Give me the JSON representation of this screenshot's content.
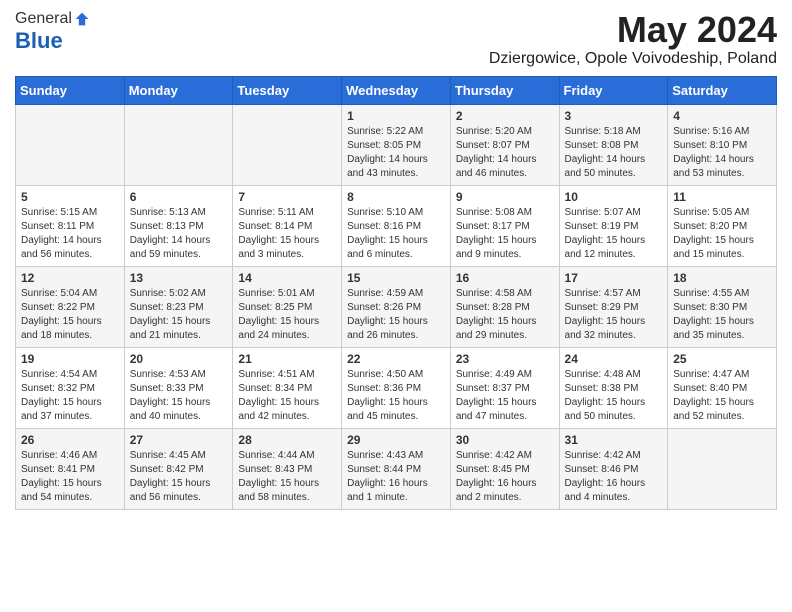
{
  "header": {
    "logo_general": "General",
    "logo_blue": "Blue",
    "month_title": "May 2024",
    "location": "Dziergowice, Opole Voivodeship, Poland"
  },
  "days_of_week": [
    "Sunday",
    "Monday",
    "Tuesday",
    "Wednesday",
    "Thursday",
    "Friday",
    "Saturday"
  ],
  "weeks": [
    [
      {
        "day": "",
        "content": ""
      },
      {
        "day": "",
        "content": ""
      },
      {
        "day": "",
        "content": ""
      },
      {
        "day": "1",
        "content": "Sunrise: 5:22 AM\nSunset: 8:05 PM\nDaylight: 14 hours\nand 43 minutes."
      },
      {
        "day": "2",
        "content": "Sunrise: 5:20 AM\nSunset: 8:07 PM\nDaylight: 14 hours\nand 46 minutes."
      },
      {
        "day": "3",
        "content": "Sunrise: 5:18 AM\nSunset: 8:08 PM\nDaylight: 14 hours\nand 50 minutes."
      },
      {
        "day": "4",
        "content": "Sunrise: 5:16 AM\nSunset: 8:10 PM\nDaylight: 14 hours\nand 53 minutes."
      }
    ],
    [
      {
        "day": "5",
        "content": "Sunrise: 5:15 AM\nSunset: 8:11 PM\nDaylight: 14 hours\nand 56 minutes."
      },
      {
        "day": "6",
        "content": "Sunrise: 5:13 AM\nSunset: 8:13 PM\nDaylight: 14 hours\nand 59 minutes."
      },
      {
        "day": "7",
        "content": "Sunrise: 5:11 AM\nSunset: 8:14 PM\nDaylight: 15 hours\nand 3 minutes."
      },
      {
        "day": "8",
        "content": "Sunrise: 5:10 AM\nSunset: 8:16 PM\nDaylight: 15 hours\nand 6 minutes."
      },
      {
        "day": "9",
        "content": "Sunrise: 5:08 AM\nSunset: 8:17 PM\nDaylight: 15 hours\nand 9 minutes."
      },
      {
        "day": "10",
        "content": "Sunrise: 5:07 AM\nSunset: 8:19 PM\nDaylight: 15 hours\nand 12 minutes."
      },
      {
        "day": "11",
        "content": "Sunrise: 5:05 AM\nSunset: 8:20 PM\nDaylight: 15 hours\nand 15 minutes."
      }
    ],
    [
      {
        "day": "12",
        "content": "Sunrise: 5:04 AM\nSunset: 8:22 PM\nDaylight: 15 hours\nand 18 minutes."
      },
      {
        "day": "13",
        "content": "Sunrise: 5:02 AM\nSunset: 8:23 PM\nDaylight: 15 hours\nand 21 minutes."
      },
      {
        "day": "14",
        "content": "Sunrise: 5:01 AM\nSunset: 8:25 PM\nDaylight: 15 hours\nand 24 minutes."
      },
      {
        "day": "15",
        "content": "Sunrise: 4:59 AM\nSunset: 8:26 PM\nDaylight: 15 hours\nand 26 minutes."
      },
      {
        "day": "16",
        "content": "Sunrise: 4:58 AM\nSunset: 8:28 PM\nDaylight: 15 hours\nand 29 minutes."
      },
      {
        "day": "17",
        "content": "Sunrise: 4:57 AM\nSunset: 8:29 PM\nDaylight: 15 hours\nand 32 minutes."
      },
      {
        "day": "18",
        "content": "Sunrise: 4:55 AM\nSunset: 8:30 PM\nDaylight: 15 hours\nand 35 minutes."
      }
    ],
    [
      {
        "day": "19",
        "content": "Sunrise: 4:54 AM\nSunset: 8:32 PM\nDaylight: 15 hours\nand 37 minutes."
      },
      {
        "day": "20",
        "content": "Sunrise: 4:53 AM\nSunset: 8:33 PM\nDaylight: 15 hours\nand 40 minutes."
      },
      {
        "day": "21",
        "content": "Sunrise: 4:51 AM\nSunset: 8:34 PM\nDaylight: 15 hours\nand 42 minutes."
      },
      {
        "day": "22",
        "content": "Sunrise: 4:50 AM\nSunset: 8:36 PM\nDaylight: 15 hours\nand 45 minutes."
      },
      {
        "day": "23",
        "content": "Sunrise: 4:49 AM\nSunset: 8:37 PM\nDaylight: 15 hours\nand 47 minutes."
      },
      {
        "day": "24",
        "content": "Sunrise: 4:48 AM\nSunset: 8:38 PM\nDaylight: 15 hours\nand 50 minutes."
      },
      {
        "day": "25",
        "content": "Sunrise: 4:47 AM\nSunset: 8:40 PM\nDaylight: 15 hours\nand 52 minutes."
      }
    ],
    [
      {
        "day": "26",
        "content": "Sunrise: 4:46 AM\nSunset: 8:41 PM\nDaylight: 15 hours\nand 54 minutes."
      },
      {
        "day": "27",
        "content": "Sunrise: 4:45 AM\nSunset: 8:42 PM\nDaylight: 15 hours\nand 56 minutes."
      },
      {
        "day": "28",
        "content": "Sunrise: 4:44 AM\nSunset: 8:43 PM\nDaylight: 15 hours\nand 58 minutes."
      },
      {
        "day": "29",
        "content": "Sunrise: 4:43 AM\nSunset: 8:44 PM\nDaylight: 16 hours\nand 1 minute."
      },
      {
        "day": "30",
        "content": "Sunrise: 4:42 AM\nSunset: 8:45 PM\nDaylight: 16 hours\nand 2 minutes."
      },
      {
        "day": "31",
        "content": "Sunrise: 4:42 AM\nSunset: 8:46 PM\nDaylight: 16 hours\nand 4 minutes."
      },
      {
        "day": "",
        "content": ""
      }
    ]
  ]
}
